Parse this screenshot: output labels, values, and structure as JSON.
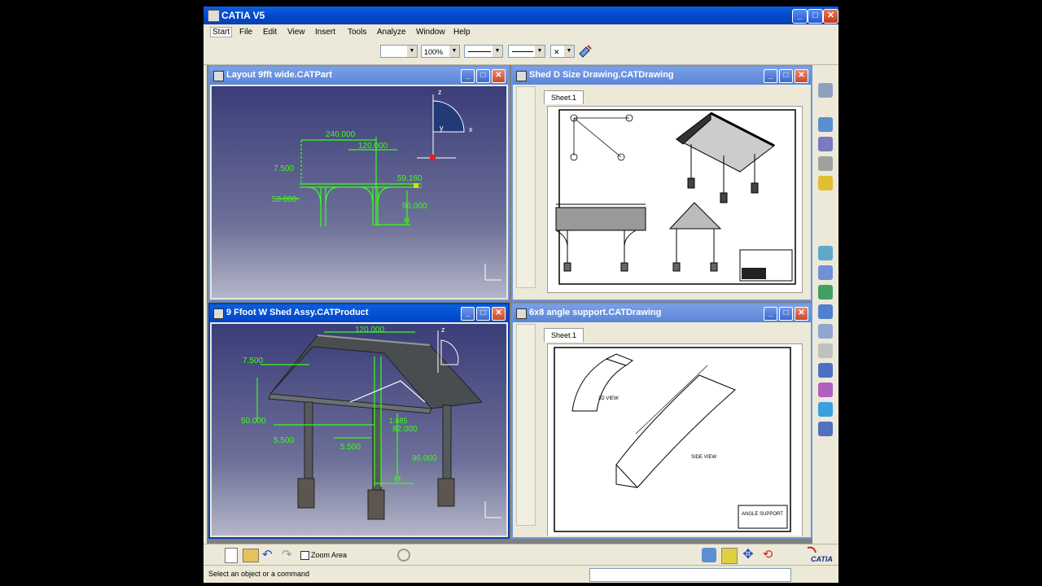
{
  "app": {
    "title": "CATIA V5"
  },
  "menu": {
    "items": [
      "Start",
      "File",
      "Edit",
      "View",
      "Insert",
      "Tools",
      "Analyze",
      "Window",
      "Help"
    ]
  },
  "toolbar": {
    "zoom": "100%"
  },
  "windows": {
    "layout": {
      "title": "Layout 9fft wide.CATPart",
      "dims": [
        "240.000",
        "120.000",
        "7.500",
        "59.160",
        "50.000",
        "96.000"
      ],
      "labels": {
        "z": "z",
        "y": "y",
        "x": "x",
        "h": "H"
      }
    },
    "drawing1": {
      "title": "Shed D Size Drawing.CATDrawing",
      "sheet": "Sheet.1"
    },
    "product": {
      "title": "9 Ffoot W Shed Assy.CATProduct",
      "dims": [
        "120.000",
        "7.500",
        "50.000",
        "5.500",
        "5.500",
        "82.000",
        "96.000",
        "1.685"
      ],
      "labels": {
        "m": "M"
      }
    },
    "drawing2": {
      "title": "6x8 angle support.CATDrawing",
      "sheet": "Sheet.1",
      "notes": [
        "3D VIEW",
        "SIDE VIEW",
        "ANGLE SUPPORT"
      ]
    }
  },
  "bottom_toolbar": {
    "zoom_area": "Zoom Area"
  },
  "status": {
    "message": "Select an object or a command"
  },
  "brand": {
    "logo_text": "CATIA"
  },
  "colors": {
    "title_active": "#0046c8",
    "dimension": "#39ff14",
    "viewport_top": "#3a3d78"
  }
}
